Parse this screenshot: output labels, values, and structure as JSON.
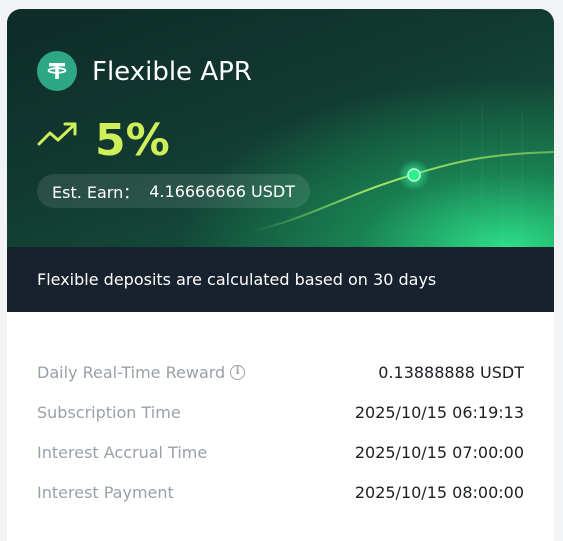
{
  "header": {
    "title": "Flexible APR",
    "apr": "5%",
    "est_earn_label": "Est. Earn：",
    "est_earn_value": "4.16666666 USDT",
    "logo_icon": "tether-icon",
    "trend_icon": "trend-up-icon",
    "accent_color": "#cff05a"
  },
  "note": {
    "text": "Flexible deposits are calculated based on 30 days"
  },
  "details": {
    "rows": [
      {
        "label": "Daily Real-Time Reward",
        "value": "0.13888888 USDT"
      },
      {
        "label": "Subscription Time",
        "value": "2025/10/15 06:19:13"
      },
      {
        "label": "Interest Accrual Time",
        "value": "2025/10/15 07:00:00"
      },
      {
        "label": "Interest Payment",
        "value": "2025/10/15 08:00:00"
      }
    ]
  }
}
